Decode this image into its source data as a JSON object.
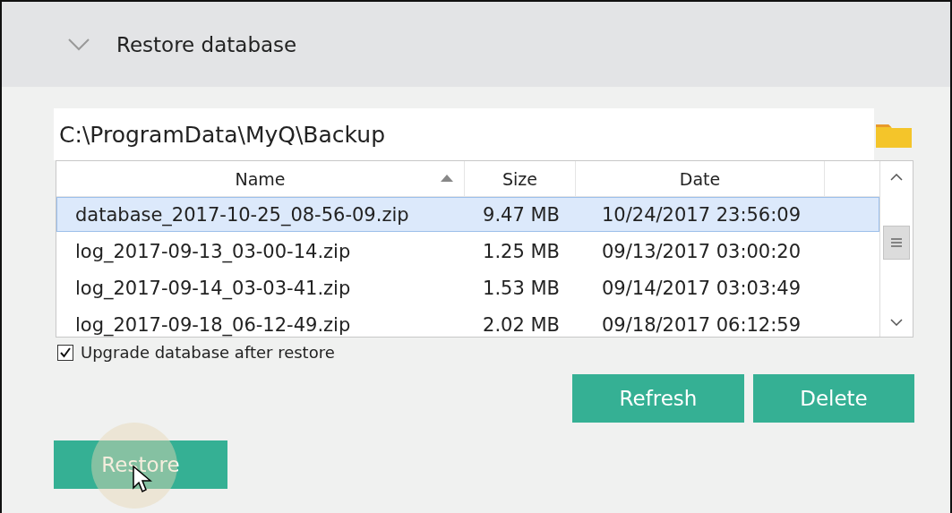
{
  "section": {
    "title": "Restore database",
    "expanded": true
  },
  "path_field": {
    "value": "C:\\ProgramData\\MyQ\\Backup"
  },
  "table": {
    "columns": [
      {
        "label": "Name",
        "sorted": true
      },
      {
        "label": "Size",
        "sorted": false
      },
      {
        "label": "Date",
        "sorted": false
      }
    ],
    "rows": [
      {
        "cells": [
          "database_2017-10-25_08-56-09.zip",
          "9.47 MB",
          "10/24/2017 23:56:09"
        ],
        "selected": true
      },
      {
        "cells": [
          "log_2017-09-13_03-00-14.zip",
          "1.25 MB",
          "09/13/2017 03:00:20"
        ],
        "selected": false
      },
      {
        "cells": [
          "log_2017-09-14_03-03-41.zip",
          "1.53 MB",
          "09/14/2017 03:03:49"
        ],
        "selected": false
      },
      {
        "cells": [
          "log_2017-09-18_06-12-49.zip",
          "2.02 MB",
          "09/18/2017 06:12:59"
        ],
        "selected": false
      }
    ]
  },
  "upgrade_checkbox": {
    "label": "Upgrade database after restore",
    "checked": true
  },
  "buttons": [
    "Refresh",
    "Delete"
  ],
  "restore_button": {
    "label": "Restore"
  }
}
